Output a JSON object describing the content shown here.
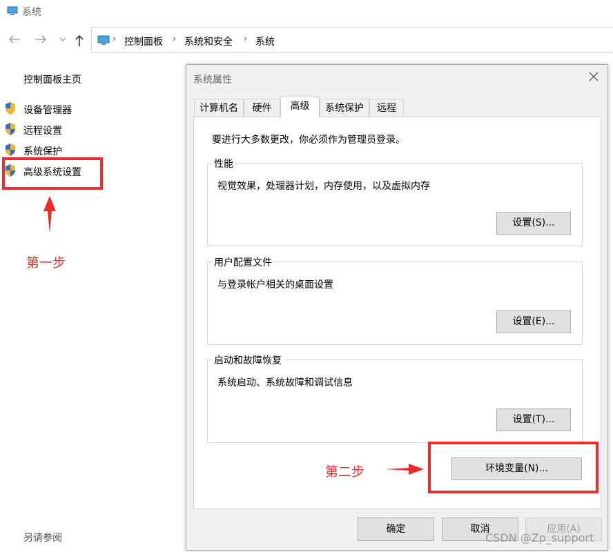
{
  "window": {
    "title": "系统"
  },
  "nav": {
    "back_icon": "arrow-left-icon",
    "forward_icon": "arrow-right-icon",
    "dropdown_icon": "chevron-down-icon",
    "up_icon": "arrow-up-icon",
    "breadcrumbs": [
      "控制面板",
      "系统和安全",
      "系统"
    ]
  },
  "left_panel": {
    "home": "控制面板主页",
    "links": [
      "设备管理器",
      "远程设置",
      "系统保护",
      "高级系统设置"
    ],
    "see_also": "另请参阅"
  },
  "dialog": {
    "title": "系统属性",
    "tabs": [
      "计算机名",
      "硬件",
      "高级",
      "系统保护",
      "远程"
    ],
    "active_tab": "高级",
    "admin_note": "要进行大多数更改，你必须作为管理员登录。",
    "groups": [
      {
        "legend": "性能",
        "desc": "视觉效果，处理器计划，内存使用，以及虚拟内存",
        "button": "设置(S)..."
      },
      {
        "legend": "用户配置文件",
        "desc": "与登录帐户相关的桌面设置",
        "button": "设置(E)..."
      },
      {
        "legend": "启动和故障恢复",
        "desc": "系统启动、系统故障和调试信息",
        "button": "设置(T)..."
      }
    ],
    "env_button": "环境变量(N)...",
    "ok": "确定",
    "cancel": "取消",
    "apply": "应用(A)"
  },
  "annotations": {
    "step1": "第一步",
    "step2": "第二步",
    "color": "#ee2b2b"
  },
  "watermark": "CSDN @Zp_support"
}
